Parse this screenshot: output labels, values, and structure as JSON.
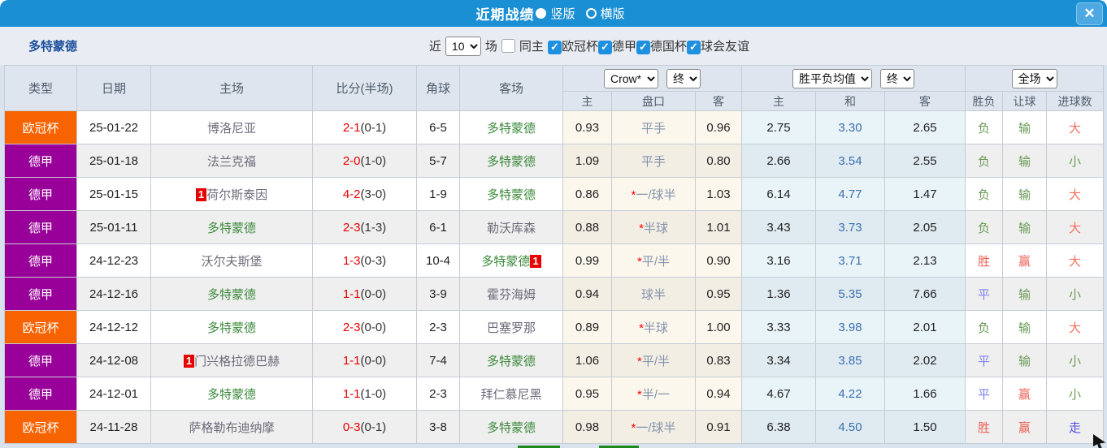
{
  "titlebar": {
    "title": "近期战绩",
    "radio_vertical": "竖版",
    "radio_horizontal": "横版",
    "close_glyph": "✕"
  },
  "filter": {
    "team": "多特蒙德",
    "recent_label": "近",
    "recent_value": "10",
    "games_label": "场",
    "same_home_label": "同主",
    "same_home_checked": false,
    "leagues": [
      {
        "label": "欧冠杯",
        "checked": true
      },
      {
        "label": "德甲",
        "checked": true
      },
      {
        "label": "德国杯",
        "checked": true
      },
      {
        "label": "球会友谊",
        "checked": true
      }
    ],
    "check_glyph": "✓"
  },
  "table": {
    "headers": {
      "type": "类型",
      "date": "日期",
      "home": "主场",
      "score": "比分(半场)",
      "corner": "角球",
      "away": "客场"
    },
    "dropdowns": {
      "odds_source": "Crow*",
      "odds_time1": "终",
      "avg_label": "胜平负均值",
      "odds_time2": "终",
      "scope": "全场"
    },
    "subheaders": [
      "主",
      "盘口",
      "客",
      "主",
      "和",
      "客",
      "胜负",
      "让球",
      "进球数"
    ],
    "rows": [
      {
        "type": "欧冠杯",
        "date": "25-01-22",
        "home": "博洛尼亚",
        "home_card": "",
        "score": "2-1",
        "half": "(0-1)",
        "corner": "6-5",
        "away": "多特蒙德",
        "away_card": "",
        "odds_home": "0.93",
        "handicap": "平手",
        "odds_away": "0.96",
        "avg_home": "2.75",
        "avg_draw": "3.30",
        "avg_away": "2.65",
        "result": "负",
        "handicap_result": "输",
        "goals": "大"
      },
      {
        "type": "德甲",
        "date": "25-01-18",
        "home": "法兰克福",
        "home_card": "",
        "score": "2-0",
        "half": "(1-0)",
        "corner": "5-7",
        "away": "多特蒙德",
        "away_card": "",
        "odds_home": "1.09",
        "handicap": "平手",
        "odds_away": "0.80",
        "avg_home": "2.66",
        "avg_draw": "3.54",
        "avg_away": "2.55",
        "result": "负",
        "handicap_result": "输",
        "goals": "小"
      },
      {
        "type": "德甲",
        "date": "25-01-15",
        "home": "荷尔斯泰因",
        "home_card": "1",
        "score": "4-2",
        "half": "(3-0)",
        "corner": "1-9",
        "away": "多特蒙德",
        "away_card": "",
        "odds_home": "0.86",
        "handicap": "*一/球半",
        "odds_away": "1.03",
        "avg_home": "6.14",
        "avg_draw": "4.77",
        "avg_away": "1.47",
        "result": "负",
        "handicap_result": "输",
        "goals": "大"
      },
      {
        "type": "德甲",
        "date": "25-01-11",
        "home": "多特蒙德",
        "home_card": "",
        "score": "2-3",
        "half": "(1-3)",
        "corner": "6-1",
        "away": "勒沃库森",
        "away_card": "",
        "odds_home": "0.88",
        "handicap": "*半球",
        "odds_away": "1.01",
        "avg_home": "3.43",
        "avg_draw": "3.73",
        "avg_away": "2.05",
        "result": "负",
        "handicap_result": "输",
        "goals": "大"
      },
      {
        "type": "德甲",
        "date": "24-12-23",
        "home": "沃尔夫斯堡",
        "home_card": "",
        "score": "1-3",
        "half": "(0-3)",
        "corner": "10-4",
        "away": "多特蒙德",
        "away_card": "1",
        "odds_home": "0.99",
        "handicap": "*平/半",
        "odds_away": "0.90",
        "avg_home": "3.16",
        "avg_draw": "3.71",
        "avg_away": "2.13",
        "result": "胜",
        "handicap_result": "赢",
        "goals": "大"
      },
      {
        "type": "德甲",
        "date": "24-12-16",
        "home": "多特蒙德",
        "home_card": "",
        "score": "1-1",
        "half": "(0-0)",
        "corner": "3-9",
        "away": "霍芬海姆",
        "away_card": "",
        "odds_home": "0.94",
        "handicap": "球半",
        "odds_away": "0.95",
        "avg_home": "1.36",
        "avg_draw": "5.35",
        "avg_away": "7.66",
        "result": "平",
        "handicap_result": "输",
        "goals": "小"
      },
      {
        "type": "欧冠杯",
        "date": "24-12-12",
        "home": "多特蒙德",
        "home_card": "",
        "score": "2-3",
        "half": "(0-0)",
        "corner": "2-3",
        "away": "巴塞罗那",
        "away_card": "",
        "odds_home": "0.89",
        "handicap": "*半球",
        "odds_away": "1.00",
        "avg_home": "3.33",
        "avg_draw": "3.98",
        "avg_away": "2.01",
        "result": "负",
        "handicap_result": "输",
        "goals": "大"
      },
      {
        "type": "德甲",
        "date": "24-12-08",
        "home": "门兴格拉德巴赫",
        "home_card": "1",
        "score": "1-1",
        "half": "(0-0)",
        "corner": "7-4",
        "away": "多特蒙德",
        "away_card": "",
        "odds_home": "1.06",
        "handicap": "*平/半",
        "odds_away": "0.83",
        "avg_home": "3.34",
        "avg_draw": "3.85",
        "avg_away": "2.02",
        "result": "平",
        "handicap_result": "输",
        "goals": "小"
      },
      {
        "type": "德甲",
        "date": "24-12-01",
        "home": "多特蒙德",
        "home_card": "",
        "score": "1-1",
        "half": "(1-0)",
        "corner": "2-3",
        "away": "拜仁慕尼黑",
        "away_card": "",
        "odds_home": "0.95",
        "handicap": "*半/一",
        "odds_away": "0.94",
        "avg_home": "4.67",
        "avg_draw": "4.22",
        "avg_away": "1.66",
        "result": "平",
        "handicap_result": "赢",
        "goals": "小"
      },
      {
        "type": "欧冠杯",
        "date": "24-11-28",
        "home": "萨格勒布迪纳摩",
        "home_card": "",
        "score": "0-3",
        "half": "(0-1)",
        "corner": "3-8",
        "away": "多特蒙德",
        "away_card": "",
        "odds_home": "0.98",
        "handicap": "*一/球半",
        "odds_away": "0.91",
        "avg_home": "6.38",
        "avg_draw": "4.50",
        "avg_away": "1.50",
        "result": "胜",
        "handicap_result": "赢",
        "goals": "走"
      }
    ]
  },
  "colors": {
    "titlebar_blue": "#1a8fd4",
    "type_badges": {
      "欧冠杯": "#f66300",
      "德甲": "#990099"
    },
    "outcome": {
      "胜": "#ee6255",
      "负": "#6a9a55",
      "平": "#8080f2",
      "输": "#6a9a55",
      "赢": "#ee6255",
      "大": "#f2705f",
      "小": "#6a9a55",
      "走": "#5050e8"
    },
    "score_red": "#e60000",
    "dortmund_green": "#3c8a3c",
    "draw_avg_blue": "#3b6fb0"
  }
}
